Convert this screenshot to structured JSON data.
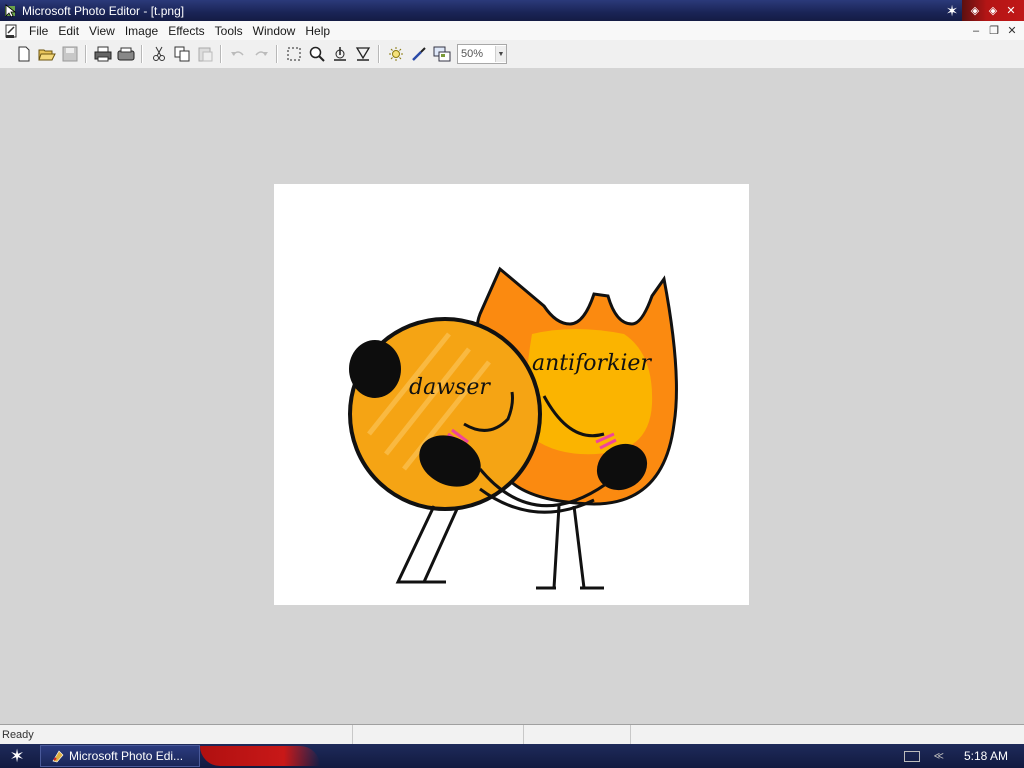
{
  "window": {
    "title": "Microsoft Photo Editor - [t.png]"
  },
  "menu": {
    "items": [
      "File",
      "Edit",
      "View",
      "Image",
      "Effects",
      "Tools",
      "Window",
      "Help"
    ]
  },
  "toolbar": {
    "buttons": [
      "new-icon",
      "open-icon",
      "save-icon",
      "print-icon",
      "scan-icon",
      "cut-icon",
      "copy-icon",
      "paste-icon",
      "undo-icon",
      "redo-icon",
      "select-icon",
      "zoom-icon",
      "smudge-icon",
      "sharpen-icon",
      "balance-icon",
      "eyedropper-icon",
      "properties-icon"
    ],
    "zoom_value": "50%"
  },
  "image": {
    "labels": {
      "left_character": "dawser",
      "right_character": "antiforkier"
    },
    "colors": {
      "orange": "#f5a414",
      "flame": "#fb8a10",
      "flame_inner": "#fbb400",
      "blush": "#f0459a"
    }
  },
  "status": {
    "text": "Ready"
  },
  "taskbar": {
    "task_label": "Microsoft Photo Edi...",
    "clock": "5:18 AM"
  }
}
